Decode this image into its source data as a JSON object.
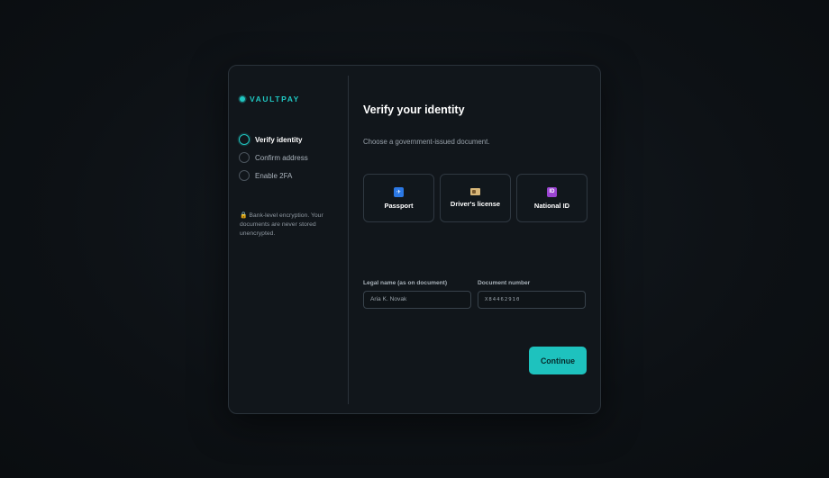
{
  "brand": {
    "name": "VAULTPAY",
    "accent_color": "#20c7c2"
  },
  "steps": [
    {
      "label": "Verify identity",
      "state": "active"
    },
    {
      "label": "Confirm address",
      "state": "pending"
    },
    {
      "label": "Enable 2FA",
      "state": "pending"
    }
  ],
  "security_note": {
    "icon": "lock-icon",
    "text": "🔒 Bank-level encryption. Your documents are never stored unencrypted."
  },
  "main": {
    "title": "Verify your identity",
    "subtitle": "Choose a government-issued document."
  },
  "documents": [
    {
      "label": "Passport",
      "icon": "passport-icon",
      "icon_glyph": "✈",
      "color": "#2b78e4"
    },
    {
      "label": "Driver's license",
      "icon": "id-card-icon",
      "icon_glyph": "",
      "color": "#d8b779"
    },
    {
      "label": "National ID",
      "icon": "national-id-icon",
      "icon_glyph": "ID",
      "color": "#9b44d2"
    }
  ],
  "fields": {
    "legal_name": {
      "label": "Legal name (as on document)",
      "value": "Aria K. Novak"
    },
    "document_number": {
      "label": "Document number",
      "value": "X84462910"
    }
  },
  "actions": {
    "continue_label": "Continue"
  }
}
